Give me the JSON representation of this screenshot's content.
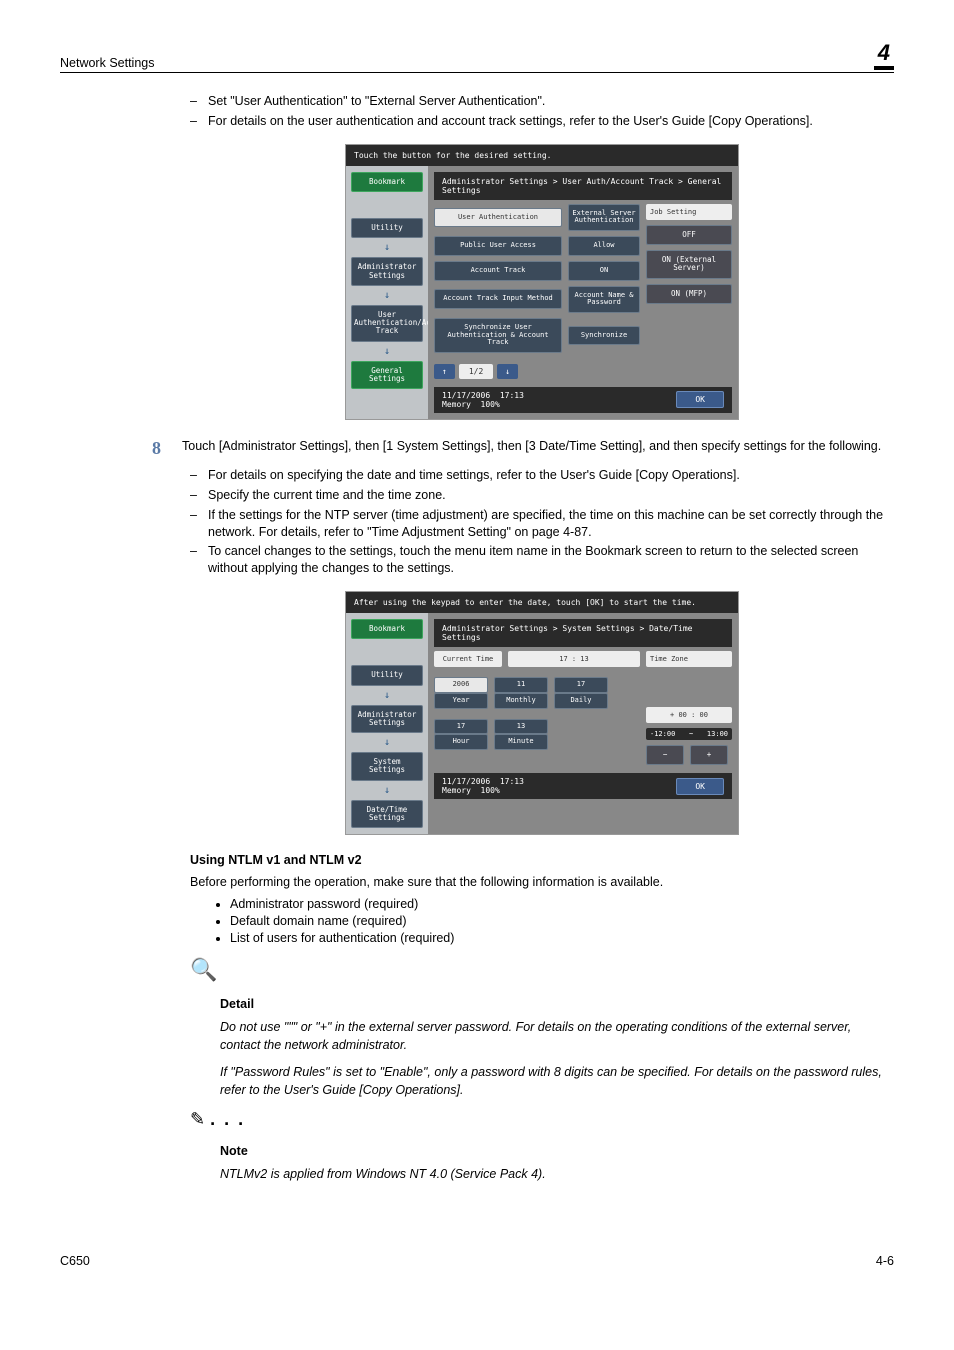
{
  "header": {
    "section": "Network Settings",
    "chapter": "4"
  },
  "intro_dashes": [
    "Set \"User Authentication\" to \"External Server Authentication\".",
    "For details on the user authentication and account track settings, refer to the User's Guide [Copy Operations]."
  ],
  "screen1": {
    "instruction": "Touch the button for the desired setting.",
    "breadcrumb": "Administrator Settings > User Auth/Account Track  > General Settings",
    "sidebar": [
      "Bookmark",
      "Utility",
      "Administrator Settings",
      "User Authentication/Account Track",
      "General Settings"
    ],
    "rows": [
      {
        "label": "User Authentication",
        "value": "External Server Authentication"
      },
      {
        "label": "Public User Access",
        "value": "Allow"
      },
      {
        "label": "Account Track",
        "value": "ON"
      },
      {
        "label": "Account Track Input Method",
        "value": "Account Name & Password"
      },
      {
        "label": "Synchronize User Authentication & Account Track",
        "value": "Synchronize"
      }
    ],
    "right": {
      "title": "Job Setting",
      "items": [
        "OFF",
        "ON (External Server)",
        "ON (MFP)"
      ]
    },
    "pager": "1/2",
    "footer": {
      "date": "11/17/2006",
      "time": "17:13",
      "mem_label": "Memory",
      "mem_val": "100%",
      "ok": "OK"
    }
  },
  "step8": {
    "num": "8",
    "text": "Touch [Administrator Settings], then [1 System Settings], then [3 Date/Time Setting], and then specify settings for the following.",
    "dashes": [
      "For details on specifying the date and time settings, refer to the User's Guide [Copy Operations].",
      "Specify the current time and the time zone.",
      "If the settings for the NTP server (time adjustment) are specified, the time on this machine can be set correctly through the network. For details, refer to \"Time Adjustment Setting\" on page 4-87.",
      "To cancel changes to the settings, touch the menu item name in the Bookmark screen to return to the selected screen without applying the changes to the settings."
    ]
  },
  "screen2": {
    "instruction": "After using the keypad to enter the date, touch [OK] to start the time.",
    "breadcrumb": "Administrator Settings > System Settings > Date/Time Settings",
    "sidebar": [
      "Bookmark",
      "Utility",
      "Administrator Settings",
      "System Settings",
      "Date/Time Settings"
    ],
    "current_time_label": "Current Time",
    "current_time": "17 : 13",
    "date": {
      "year": "2006",
      "year_l": "Year",
      "month": "11",
      "month_l": "Monthly",
      "day": "17",
      "day_l": "Daily"
    },
    "time": {
      "hour": "17",
      "hour_l": "Hour",
      "min": "13",
      "min_l": "Minute"
    },
    "tz": {
      "title": "Time Zone",
      "val": "+ 00 : 00",
      "range_l": "-12:00",
      "range_r": "13:00",
      "minus": "−",
      "plus": "+"
    },
    "footer": {
      "date": "11/17/2006",
      "time": "17:13",
      "mem_label": "Memory",
      "mem_val": "100%",
      "ok": "OK"
    }
  },
  "ntlm": {
    "heading": "Using NTLM v1 and NTLM v2",
    "intro": "Before performing the operation, make sure that the following information is available.",
    "bullets": [
      "Administrator password (required)",
      "Default domain name (required)",
      "List of users for authentication (required)"
    ]
  },
  "detail": {
    "heading": "Detail",
    "p1": "Do not use \"\"\" or \"+\" in the external server password. For details on the operating conditions of the external server, contact the network administrator.",
    "p2": "If \"Password Rules\" is set to \"Enable\", only a password with 8 digits can be specified. For details on the password rules, refer to the User's Guide [Copy Operations]."
  },
  "note": {
    "heading": "Note",
    "p1": "NTLMv2 is applied from Windows NT 4.0 (Service Pack 4)."
  },
  "footer": {
    "left": "C650",
    "right": "4-6"
  }
}
